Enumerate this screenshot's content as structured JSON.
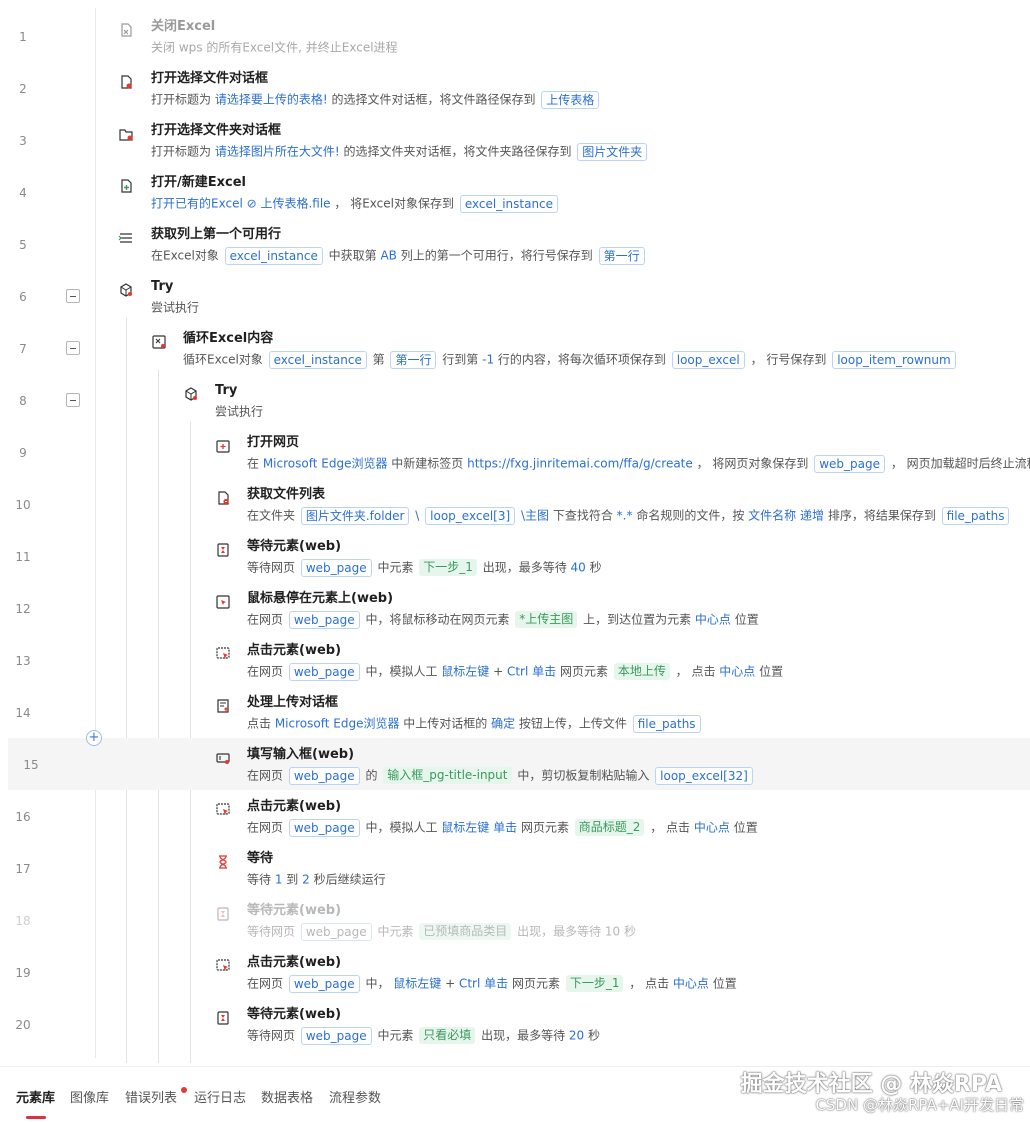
{
  "rows": [
    {
      "ln": "1",
      "title": "关闭Excel",
      "desc": [
        {
          "t": "关闭 "
        },
        {
          "t": "wps",
          "c": "v"
        },
        {
          "t": " 的所有Excel文件, 并终止Excel进程"
        }
      ]
    },
    {
      "ln": "2",
      "title": "打开选择文件对话框",
      "desc": [
        {
          "t": "打开标题为 "
        },
        {
          "t": "请选择要上传的表格!",
          "c": "v"
        },
        {
          "t": " 的选择文件对话框，将文件路径保存到 "
        },
        {
          "t": "上传表格",
          "c": "tg"
        }
      ]
    },
    {
      "ln": "3",
      "title": "打开选择文件夹对话框",
      "desc": [
        {
          "t": "打开标题为 "
        },
        {
          "t": "请选择图片所在大文件!",
          "c": "v"
        },
        {
          "t": " 的选择文件夹对话框，将文件夹路径保存到 "
        },
        {
          "t": "图片文件夹",
          "c": "tg"
        }
      ]
    },
    {
      "ln": "4",
      "title": "打开/新建Excel",
      "desc": [
        {
          "t": "打开已有的Excel ",
          "c": "v"
        },
        {
          "t": "⊘ 上传表格.file",
          "c": "v"
        },
        {
          "t": " ， 将Excel对象保存到 "
        },
        {
          "t": "excel_instance",
          "c": "tg"
        }
      ]
    },
    {
      "ln": "5",
      "title": "获取列上第一个可用行",
      "desc": [
        {
          "t": "在Excel对象 "
        },
        {
          "t": "excel_instance",
          "c": "tg"
        },
        {
          "t": " 中获取第 "
        },
        {
          "t": "AB",
          "c": "v"
        },
        {
          "t": " 列上的第一个可用行，将行号保存到 "
        },
        {
          "t": "第一行",
          "c": "tg"
        }
      ]
    },
    {
      "ln": "6",
      "title": "Try",
      "desc": [
        {
          "t": "尝试执行"
        }
      ]
    },
    {
      "ln": "7",
      "title": "循环Excel内容",
      "desc": [
        {
          "t": "循环Excel对象 "
        },
        {
          "t": "excel_instance",
          "c": "tg"
        },
        {
          "t": " 第 "
        },
        {
          "t": "第一行",
          "c": "tg"
        },
        {
          "t": " 行到第 "
        },
        {
          "t": "-1",
          "c": "v"
        },
        {
          "t": " 行的内容，将每次循环项保存到 "
        },
        {
          "t": "loop_excel",
          "c": "tg"
        },
        {
          "t": " ， 行号保存到 "
        },
        {
          "t": "loop_item_rownum",
          "c": "tg"
        }
      ]
    },
    {
      "ln": "8",
      "title": "Try",
      "desc": [
        {
          "t": "尝试执行"
        }
      ]
    },
    {
      "ln": "9",
      "title": "打开网页",
      "desc": [
        {
          "t": "在 "
        },
        {
          "t": "Microsoft Edge浏览器",
          "c": "v"
        },
        {
          "t": " 中新建标签页 "
        },
        {
          "t": "https://fxg.jinritemai.com/ffa/g/create",
          "c": "v"
        },
        {
          "t": " ， 将网页对象保存到 "
        },
        {
          "t": "web_page",
          "c": "tg"
        },
        {
          "t": " ， 网页加载超时后终止流程"
        }
      ]
    },
    {
      "ln": "10",
      "title": "获取文件列表",
      "desc": [
        {
          "t": "在文件夹 "
        },
        {
          "t": "图片文件夹.folder",
          "c": "tg"
        },
        {
          "t": " \\ ",
          "c": "v"
        },
        {
          "t": "loop_excel[3]",
          "c": "tg"
        },
        {
          "t": " \\主图",
          "c": "v"
        },
        {
          "t": " 下查找符合 "
        },
        {
          "t": "*.*",
          "c": "v"
        },
        {
          "t": " 命名规则的文件，按 "
        },
        {
          "t": "文件名称",
          "c": "v"
        },
        {
          "t": " "
        },
        {
          "t": "递增",
          "c": "v"
        },
        {
          "t": " 排序，将结果保存到 "
        },
        {
          "t": "file_paths",
          "c": "tg"
        }
      ]
    },
    {
      "ln": "11",
      "title": "等待元素(web)",
      "desc": [
        {
          "t": "等待网页 "
        },
        {
          "t": "web_page",
          "c": "tg"
        },
        {
          "t": " 中元素 "
        },
        {
          "t": "下一步_1",
          "c": "el"
        },
        {
          "t": " 出现，最多等待 "
        },
        {
          "t": "40",
          "c": "v"
        },
        {
          "t": " 秒"
        }
      ]
    },
    {
      "ln": "12",
      "title": "鼠标悬停在元素上(web)",
      "desc": [
        {
          "t": "在网页 "
        },
        {
          "t": "web_page",
          "c": "tg"
        },
        {
          "t": " 中，将鼠标移动在网页元素 "
        },
        {
          "t": "*上传主图",
          "c": "el"
        },
        {
          "t": " 上，到达位置为元素 "
        },
        {
          "t": "中心点",
          "c": "v"
        },
        {
          "t": " 位置"
        }
      ]
    },
    {
      "ln": "13",
      "title": "点击元素(web)",
      "desc": [
        {
          "t": "在网页 "
        },
        {
          "t": "web_page",
          "c": "tg"
        },
        {
          "t": " 中，模拟人工 "
        },
        {
          "t": "鼠标左键",
          "c": "v"
        },
        {
          "t": " + "
        },
        {
          "t": "Ctrl",
          "c": "v"
        },
        {
          "t": " "
        },
        {
          "t": "单击",
          "c": "v"
        },
        {
          "t": " 网页元素 "
        },
        {
          "t": "本地上传",
          "c": "el"
        },
        {
          "t": " ， 点击 "
        },
        {
          "t": "中心点",
          "c": "v"
        },
        {
          "t": " 位置"
        }
      ]
    },
    {
      "ln": "14",
      "title": "处理上传对话框",
      "desc": [
        {
          "t": "点击 "
        },
        {
          "t": "Microsoft Edge浏览器",
          "c": "v"
        },
        {
          "t": " 中上传对话框的 "
        },
        {
          "t": "确定",
          "c": "v"
        },
        {
          "t": " 按钮上传，上传文件 "
        },
        {
          "t": "file_paths",
          "c": "tg"
        }
      ]
    },
    {
      "ln": "15",
      "title": "填写输入框(web)",
      "desc": [
        {
          "t": "在网页 "
        },
        {
          "t": "web_page",
          "c": "tg"
        },
        {
          "t": " 的 "
        },
        {
          "t": "输入框_pg-title-input",
          "c": "el"
        },
        {
          "t": " 中，剪切板复制粘贴输入 "
        },
        {
          "t": "loop_excel[32]",
          "c": "tg"
        }
      ]
    },
    {
      "ln": "16",
      "title": "点击元素(web)",
      "desc": [
        {
          "t": "在网页 "
        },
        {
          "t": "web_page",
          "c": "tg"
        },
        {
          "t": " 中，模拟人工 "
        },
        {
          "t": "鼠标左键",
          "c": "v"
        },
        {
          "t": " "
        },
        {
          "t": "单击",
          "c": "v"
        },
        {
          "t": " 网页元素 "
        },
        {
          "t": "商品标题_2",
          "c": "el"
        },
        {
          "t": " ， 点击 "
        },
        {
          "t": "中心点",
          "c": "v"
        },
        {
          "t": " 位置"
        }
      ]
    },
    {
      "ln": "17",
      "title": "等待",
      "desc": [
        {
          "t": "等待 "
        },
        {
          "t": "1",
          "c": "v"
        },
        {
          "t": " 到 "
        },
        {
          "t": "2",
          "c": "v"
        },
        {
          "t": " 秒后继续运行"
        }
      ]
    },
    {
      "ln": "18",
      "title": "等待元素(web)",
      "desc": [
        {
          "t": "等待网页 "
        },
        {
          "t": "web_page",
          "c": "tg"
        },
        {
          "t": " 中元素 "
        },
        {
          "t": "已预填商品类目",
          "c": "el"
        },
        {
          "t": " 出现，最多等待 "
        },
        {
          "t": "10",
          "c": "v"
        },
        {
          "t": " 秒"
        }
      ]
    },
    {
      "ln": "19",
      "title": "点击元素(web)",
      "desc": [
        {
          "t": "在网页 "
        },
        {
          "t": "web_page",
          "c": "tg"
        },
        {
          "t": " 中， "
        },
        {
          "t": "鼠标左键",
          "c": "v"
        },
        {
          "t": " + "
        },
        {
          "t": "Ctrl",
          "c": "v"
        },
        {
          "t": " "
        },
        {
          "t": "单击",
          "c": "v"
        },
        {
          "t": " 网页元素 "
        },
        {
          "t": "下一步_1",
          "c": "el"
        },
        {
          "t": " ， 点击 "
        },
        {
          "t": "中心点",
          "c": "v"
        },
        {
          "t": " 位置"
        }
      ]
    },
    {
      "ln": "20",
      "title": "等待元素(web)",
      "desc": [
        {
          "t": "等待网页 "
        },
        {
          "t": "web_page",
          "c": "tg"
        },
        {
          "t": " 中元素 "
        },
        {
          "t": "只看必填",
          "c": "el"
        },
        {
          "t": " 出现，最多等待 "
        },
        {
          "t": "20",
          "c": "v"
        },
        {
          "t": " 秒"
        }
      ]
    }
  ],
  "tabs": [
    {
      "label": "元素库",
      "active": true
    },
    {
      "label": "图像库"
    },
    {
      "label": "错误列表"
    },
    {
      "label": "运行日志"
    },
    {
      "label": "数据表格"
    },
    {
      "label": "流程参数"
    }
  ],
  "watermark": {
    "main": "掘金技术社区 @ 林焱RPA",
    "sub": "CSDN @林焱RPA+AI开发日常"
  },
  "colors": {
    "accent": "#2a6fd6",
    "element": "#3a9a5c",
    "badge": "#e53935",
    "active_tab": "#e0303e"
  }
}
